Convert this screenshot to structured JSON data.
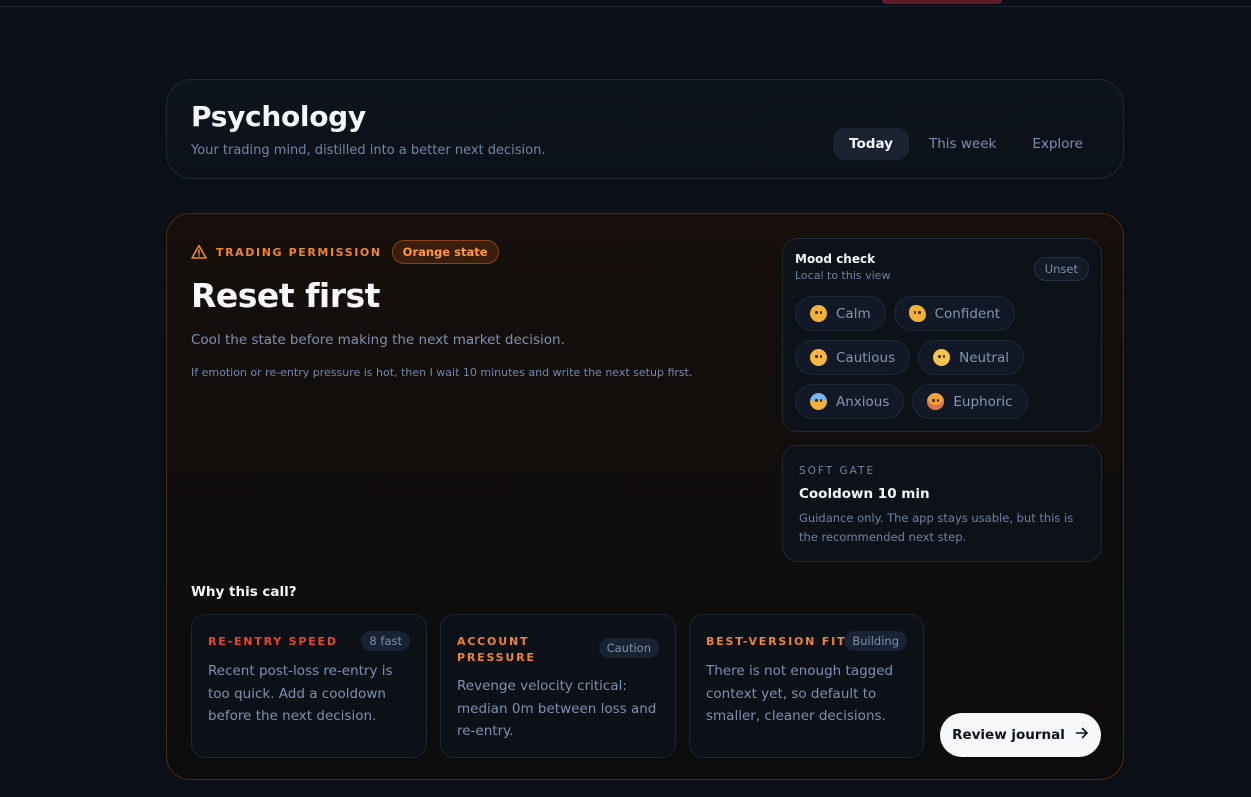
{
  "header": {
    "title": "Psychology",
    "subtitle": "Your trading mind, distilled into a better next decision.",
    "tabs": [
      {
        "label": "Today",
        "active": true
      },
      {
        "label": "This week",
        "active": false
      },
      {
        "label": "Explore",
        "active": false
      }
    ]
  },
  "permission": {
    "label": "TRADING PERMISSION",
    "state_badge": "Orange state",
    "headline": "Reset first",
    "lead": "Cool the state before making the next market decision.",
    "rule": "If emotion or re-entry pressure is hot, then I wait 10 minutes and write the next setup first.",
    "icon": "warning-triangle-icon"
  },
  "mood": {
    "title": "Mood check",
    "subtitle": "Local to this view",
    "status": "Unset",
    "options": [
      {
        "label": "Calm",
        "icon": "relieved-face-icon"
      },
      {
        "label": "Confident",
        "icon": "flexed-biceps-icon"
      },
      {
        "label": "Cautious",
        "icon": "thinking-face-icon"
      },
      {
        "label": "Neutral",
        "icon": "neutral-face-icon"
      },
      {
        "label": "Anxious",
        "icon": "anxious-face-icon"
      },
      {
        "label": "Euphoric",
        "icon": "star-struck-face-icon"
      }
    ]
  },
  "gate": {
    "label": "SOFT GATE",
    "title": "Cooldown 10 min",
    "body": "Guidance only. The app stays usable, but this is the recommended next step."
  },
  "why": {
    "title": "Why this call?",
    "cards": [
      {
        "title": "RE-ENTRY SPEED",
        "tag": "8 fast",
        "body": "Recent post-loss re-entry is too quick. Add a cooldown before the next decision."
      },
      {
        "title": "ACCOUNT PRESSURE",
        "tag": "Caution",
        "body": "Revenge velocity critical: median 0m between loss and re-entry."
      },
      {
        "title": "BEST-VERSION FIT",
        "tag": "Building",
        "body": "There is not enough tagged context yet, so default to smaller, cleaner decisions."
      }
    ]
  },
  "actions": {
    "review_label": "Review journal",
    "review_icon": "arrow-right-icon"
  },
  "colors": {
    "accent_orange": "#f0842c",
    "alert_red": "#e8452f",
    "background": "#0b0f16"
  }
}
